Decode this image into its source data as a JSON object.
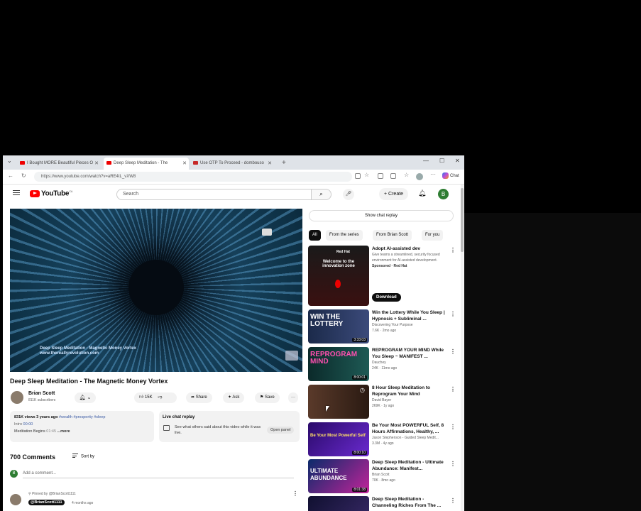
{
  "colors": {
    "accent_red": "#ff0000",
    "avatar_green": "#2e7d32"
  },
  "tabs": [
    {
      "label": "I Bought MORE Beautiful Pieces O"
    },
    {
      "label": "Deep Sleep Meditation - The"
    },
    {
      "label": "Use OTP To Proceed - dombouso"
    }
  ],
  "address": {
    "url": "https://www.youtube.com/watch?v=aRE4tL_vXW8"
  },
  "browser": {
    "copilot_label": "Chat"
  },
  "yt": {
    "logo": "YouTube",
    "logo_sup": "CA",
    "search_placeholder": "Search",
    "create_label": "Create",
    "avatar_letter": "B"
  },
  "video": {
    "watermark_line1": "Deep Sleep Meditation - Magnetic Money Vortex",
    "watermark_line2": "www.thereallyrevolution.com",
    "title": "Deep Sleep Meditation - The Magnetic Money Vortex",
    "channel": "Brian Scott",
    "subs": "811K subscribers",
    "like_count": "15K",
    "share_label": "Share",
    "ask_label": "Ask",
    "save_label": "Save"
  },
  "description": {
    "views_date": "831K views 3 years ago",
    "tags": "#wealth #prosperity #sleep",
    "intro": "Intro",
    "intro_time": "00:00",
    "line3_text": "Meditation Begins",
    "line3_time": "01:45",
    "more": "...more"
  },
  "live_replay": {
    "title": "Live chat replay",
    "text": "See what others said about this video while it was live.",
    "button": "Open panel"
  },
  "comments": {
    "count": "700 Comments",
    "sort": "Sort by",
    "add_placeholder": "Add a comment...",
    "pinned_by": "Pinned by @BrianScott1111",
    "first_author": "@BrianScott1111",
    "first_time": "4 months ago"
  },
  "sidebar": {
    "show_chat": "Show chat replay",
    "chips": [
      "All",
      "From the series",
      "From Brian Scott",
      "For you"
    ],
    "ad": {
      "thumb_brand": "Red Hat",
      "thumb_text": "Welcome to the innovation zone",
      "title": "Adopt AI-assisted dev",
      "desc": "Give teams a streamlined, security focused environment for AI-assisted development.",
      "sponsored": "Sponsored · Red Hat",
      "button": "Download"
    },
    "videos": [
      {
        "thumb_text": "WIN THE LOTTERY",
        "title": "Win the Lottery While You Sleep | Hypnosis + Subliminal ...",
        "channel": "Discovering Your Purpose",
        "meta": "7.6K · 2mo ago",
        "duration": "3:33:03"
      },
      {
        "thumb_text": "REPROGRAM MIND",
        "title": "REPROGRAM YOUR MIND While You Sleep ~ MANIFEST ...",
        "channel": "Dauchey",
        "meta": "24K · 11mo ago",
        "duration": "8:00:01"
      },
      {
        "thumb_text": "",
        "title": "8 Hour Sleep Meditation to Reprogram Your Mind",
        "channel": "David Bayer",
        "meta": "269K · 1y ago",
        "duration": ""
      },
      {
        "thumb_text": "Be Your Most Powerful Self",
        "title": "Be Your Most POWERFUL Self, 8 Hours Affirmations, Healthy, ...",
        "channel": "Jason Stephenson - Guided Sleep Medit...",
        "meta": "3.3M · 4y ago",
        "duration": "8:00:10"
      },
      {
        "thumb_text": "ULTIMATE ABUNDANCE",
        "title": "Deep Sleep Meditation - Ultimate Abundance: Manifest...",
        "channel": "Brian Scott",
        "meta": "70K · 8mo ago",
        "duration": "8:01:38"
      },
      {
        "thumb_text": "",
        "title": "Deep Sleep Meditation - Channeling Riches From The ...",
        "channel": "",
        "meta": "",
        "duration": ""
      }
    ]
  }
}
